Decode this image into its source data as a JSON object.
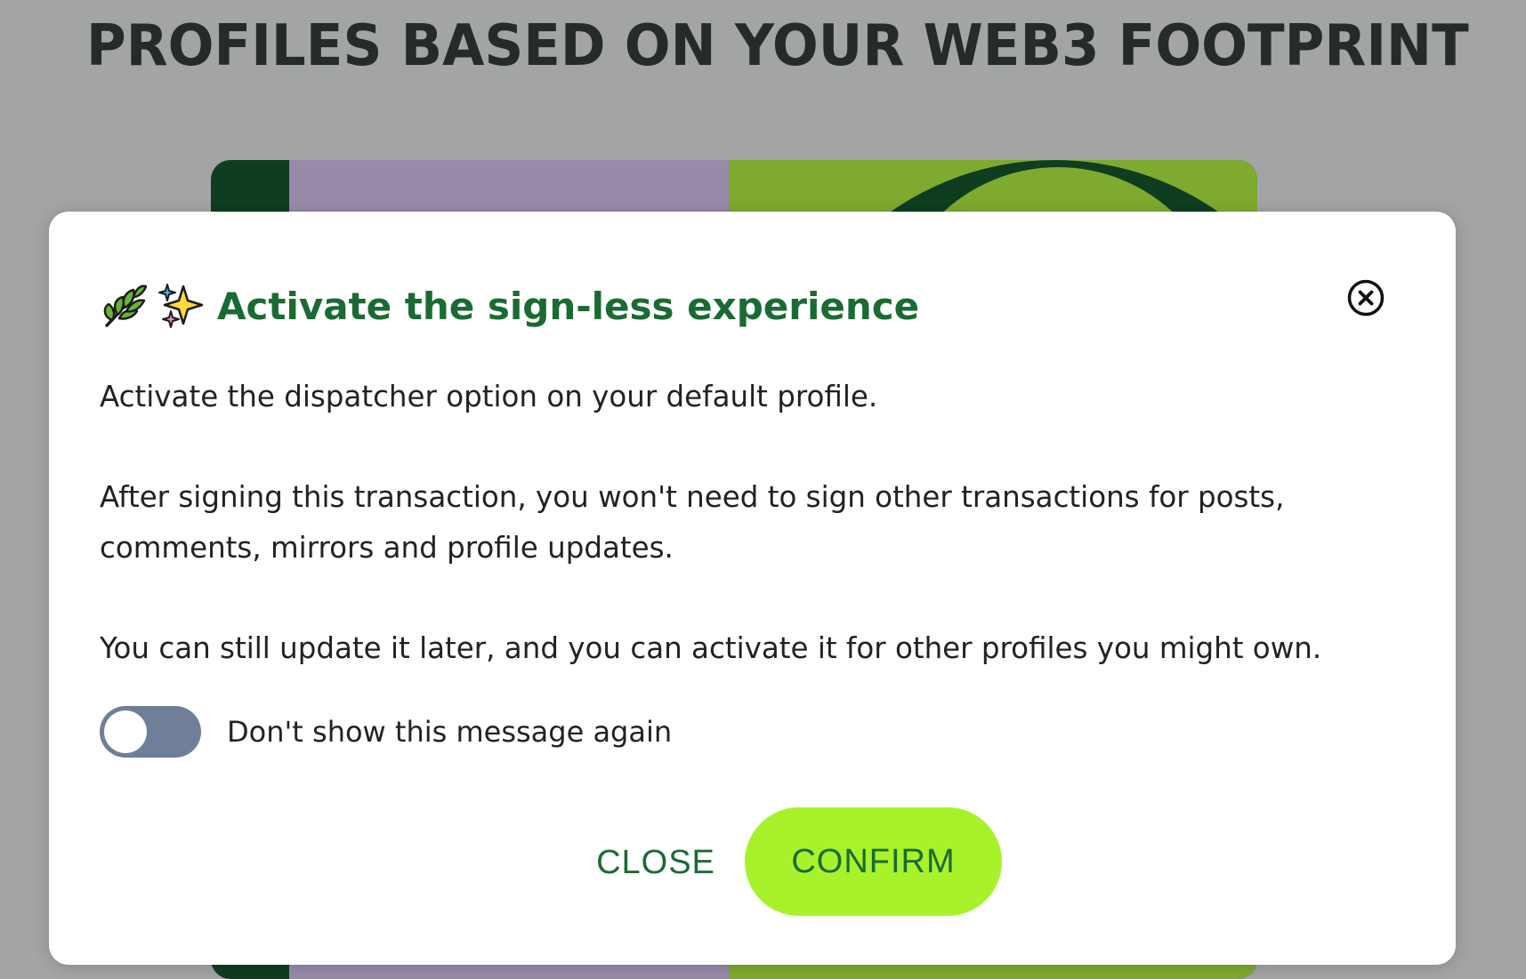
{
  "background": {
    "heading": "PROFILES BASED ON YOUR WEB3 FOOTPRINT"
  },
  "modal": {
    "title": "Activate the sign-less experience",
    "title_icons": [
      "herb-icon",
      "sparkles-icon"
    ],
    "paragraph_1": "Activate the dispatcher option on your default profile.",
    "paragraph_2": "After signing this transaction, you won't need to sign other transactions for posts, comments, mirrors and profile updates.",
    "paragraph_3": "You can still update it later, and you can activate it for other profiles you might own.",
    "toggle": {
      "label": "Don't show this message again",
      "checked": false
    },
    "close_label": "CLOSE",
    "confirm_label": "CONFIRM"
  },
  "colors": {
    "page_overlay": "#a3a4a6",
    "heading_text": "#262b27",
    "modal_bg": "#ffffff",
    "title_green": "#1a6b33",
    "confirm_bg": "#a8f22c",
    "toggle_off": "#6f7f99",
    "card_dark_green": "#0e3d20",
    "card_purple": "#998aaa",
    "card_light_green": "#7eaa30"
  }
}
